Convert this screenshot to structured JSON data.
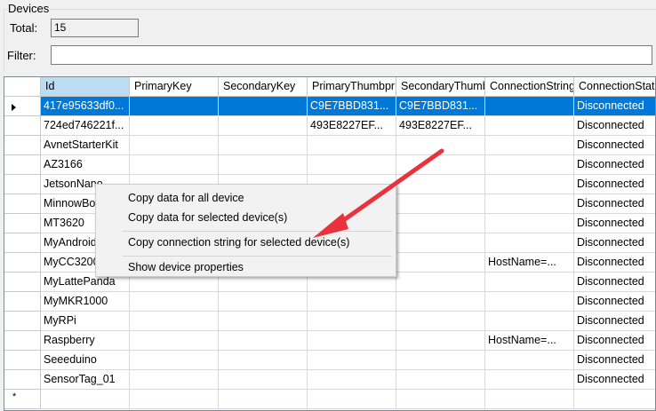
{
  "group": {
    "title": "Devices"
  },
  "total": {
    "label": "Total:",
    "value": "15"
  },
  "filter": {
    "label": "Filter:",
    "value": ""
  },
  "columns": [
    "Id",
    "PrimaryKey",
    "SecondaryKey",
    "PrimaryThumbprint",
    "SecondaryThumbprint",
    "ConnectionString",
    "ConnectionState"
  ],
  "rows": [
    [
      "417e95633df0...",
      "",
      "",
      "C9E7BBD831...",
      "C9E7BBD831...",
      "",
      "Disconnected"
    ],
    [
      "724ed746221f...",
      "",
      "",
      "493E8227EF...",
      "493E8227EF...",
      "",
      "Disconnected"
    ],
    [
      "AvnetStarterKit",
      "",
      "",
      "",
      "",
      "",
      "Disconnected"
    ],
    [
      "AZ3166",
      "",
      "",
      "",
      "",
      "",
      "Disconnected"
    ],
    [
      "JetsonNano",
      "",
      "",
      "",
      "",
      "",
      "Disconnected"
    ],
    [
      "MinnowBoard",
      "",
      "",
      "",
      "",
      "",
      "Disconnected"
    ],
    [
      "MT3620",
      "",
      "",
      "",
      "",
      "",
      "Disconnected"
    ],
    [
      "MyAndroid",
      "",
      "",
      "",
      "",
      "",
      "Disconnected"
    ],
    [
      "MyCC3200",
      "",
      "",
      "",
      "",
      "HostName=...",
      "Disconnected"
    ],
    [
      "MyLattePanda",
      "",
      "",
      "",
      "",
      "",
      "Disconnected"
    ],
    [
      "MyMKR1000",
      "",
      "",
      "",
      "",
      "",
      "Disconnected"
    ],
    [
      "MyRPi",
      "",
      "",
      "",
      "",
      "",
      "Disconnected"
    ],
    [
      "Raspberry",
      "",
      "",
      "",
      "",
      "HostName=...",
      "Disconnected"
    ],
    [
      "Seeeduino",
      "",
      "",
      "",
      "",
      "",
      "Disconnected"
    ],
    [
      "SensorTag_01",
      "",
      "",
      "",
      "",
      "",
      "Disconnected"
    ]
  ],
  "new_row_marker": "*",
  "context_menu": {
    "items": [
      "Copy data for all device",
      "Copy data for selected device(s)",
      "Copy connection string for selected device(s)",
      "Show device properties"
    ]
  },
  "colors": {
    "selection": "#0078d7",
    "annotation_arrow": "#e8323c"
  }
}
